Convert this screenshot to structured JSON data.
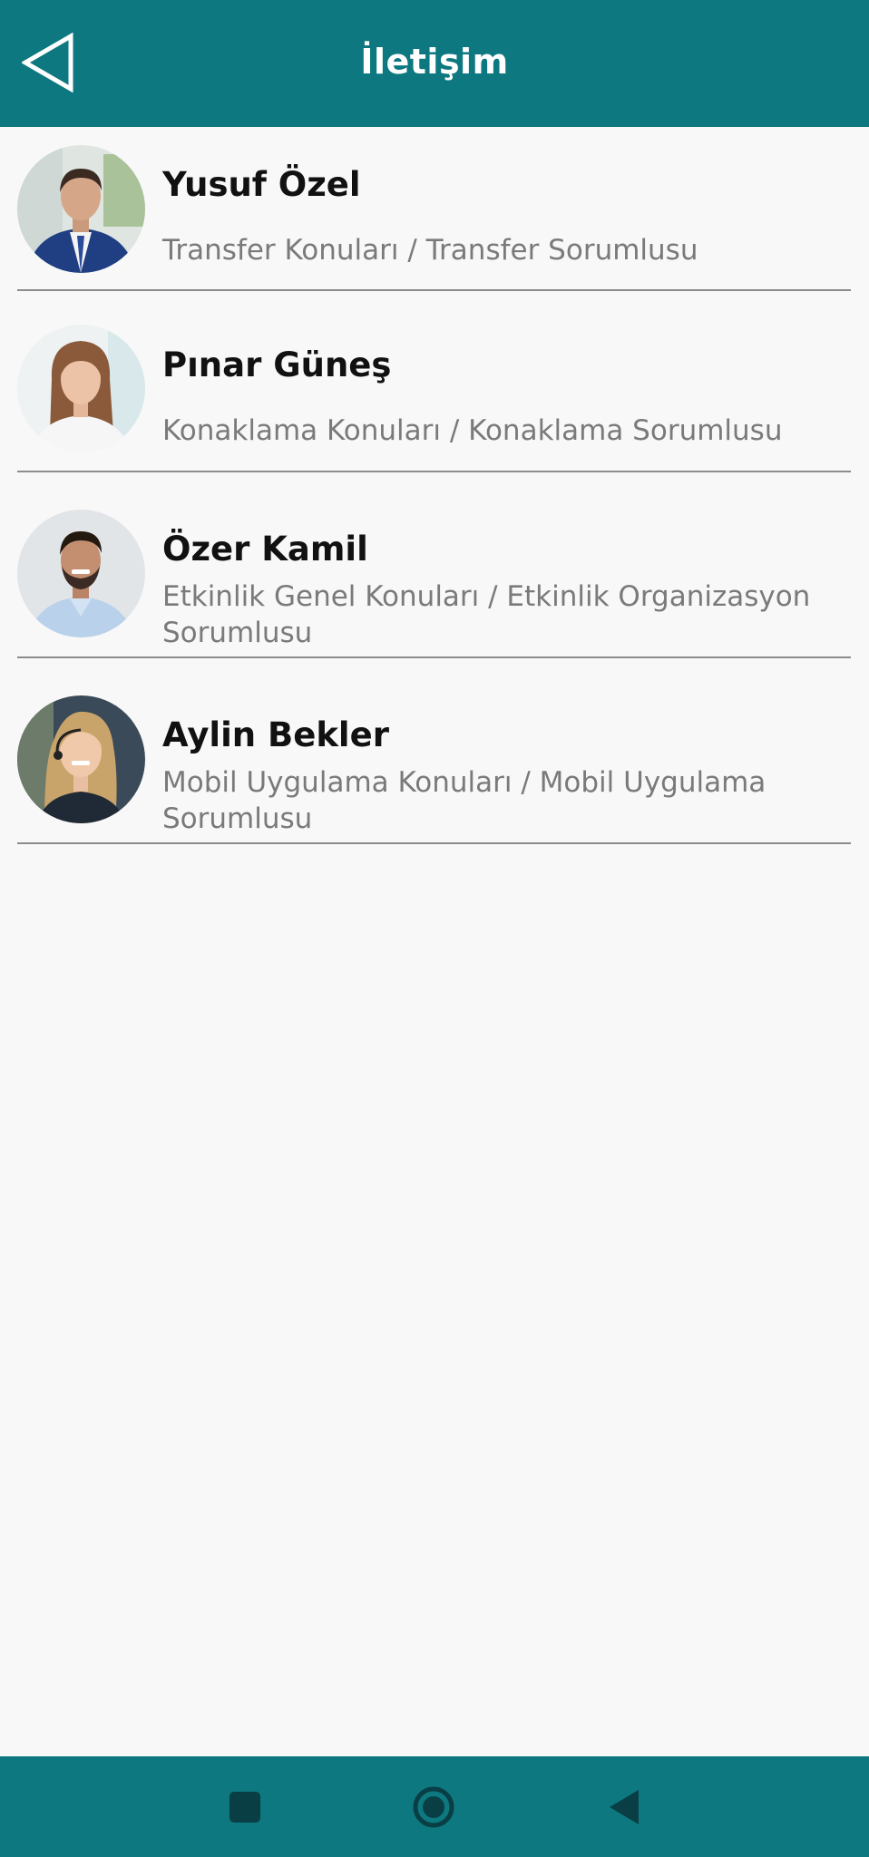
{
  "header": {
    "title": "İletişim",
    "back_icon": "back-arrow-icon",
    "background_color": "#0d7880"
  },
  "contacts": [
    {
      "name": "Yusuf Özel",
      "role": "Transfer Konuları / Transfer Sorumlusu",
      "avatar": "avatar-man-suit"
    },
    {
      "name": "Pınar Güneş",
      "role": "Konaklama Konuları / Konaklama Sorumlusu",
      "avatar": "avatar-woman-long-hair"
    },
    {
      "name": "Özer Kamil",
      "role": "Etkinlik Genel Konuları / Etkinlik Organizasyon Sorumlusu",
      "avatar": "avatar-man-beard"
    },
    {
      "name": "Aylin Bekler",
      "role": "Mobil Uygulama Konuları / Mobil Uygulama Sorumlusu",
      "avatar": "avatar-woman-headset"
    }
  ],
  "system_nav": {
    "recents_icon": "square-icon",
    "home_icon": "circle-icon",
    "back_icon": "triangle-back-icon",
    "background_color": "#0d7880"
  }
}
